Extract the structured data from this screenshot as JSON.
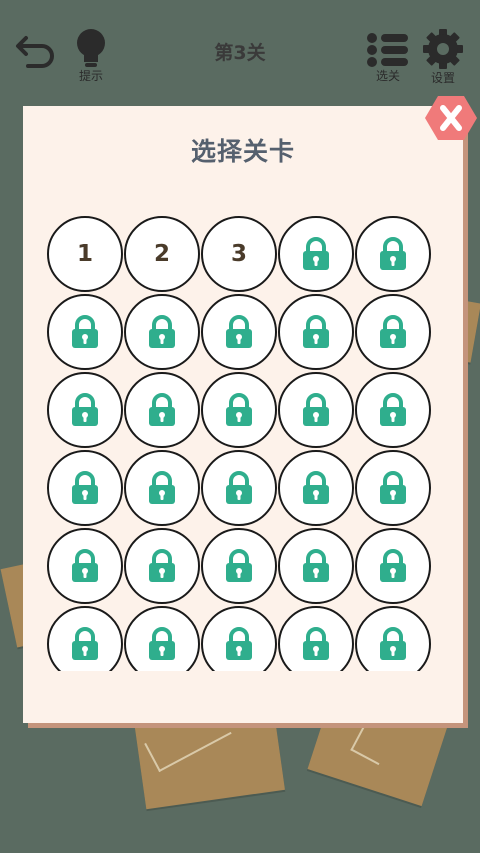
{
  "header": {
    "back_icon": "undo-arrow-icon",
    "hint_label": "提示",
    "level_title": "第3关",
    "select_label": "选关",
    "settings_label": "设置"
  },
  "dialog": {
    "title": "选择关卡",
    "close_icon": "close-x-icon"
  },
  "levels": [
    {
      "label": "1",
      "locked": false
    },
    {
      "label": "2",
      "locked": false
    },
    {
      "label": "3",
      "locked": false
    },
    {
      "label": "",
      "locked": true
    },
    {
      "label": "",
      "locked": true
    },
    {
      "label": "",
      "locked": true
    },
    {
      "label": "",
      "locked": true
    },
    {
      "label": "",
      "locked": true
    },
    {
      "label": "",
      "locked": true
    },
    {
      "label": "",
      "locked": true
    },
    {
      "label": "",
      "locked": true
    },
    {
      "label": "",
      "locked": true
    },
    {
      "label": "",
      "locked": true
    },
    {
      "label": "",
      "locked": true
    },
    {
      "label": "",
      "locked": true
    },
    {
      "label": "",
      "locked": true
    },
    {
      "label": "",
      "locked": true
    },
    {
      "label": "",
      "locked": true
    },
    {
      "label": "",
      "locked": true
    },
    {
      "label": "",
      "locked": true
    },
    {
      "label": "",
      "locked": true
    },
    {
      "label": "",
      "locked": true
    },
    {
      "label": "",
      "locked": true
    },
    {
      "label": "",
      "locked": true
    },
    {
      "label": "",
      "locked": true
    },
    {
      "label": "",
      "locked": true
    },
    {
      "label": "",
      "locked": true
    },
    {
      "label": "",
      "locked": true
    },
    {
      "label": "",
      "locked": true
    },
    {
      "label": "",
      "locked": true
    }
  ],
  "colors": {
    "background": "#5a6b61",
    "panel": "#fdf2ea",
    "lock": "#2fae8d",
    "close": "#f07a7a"
  }
}
